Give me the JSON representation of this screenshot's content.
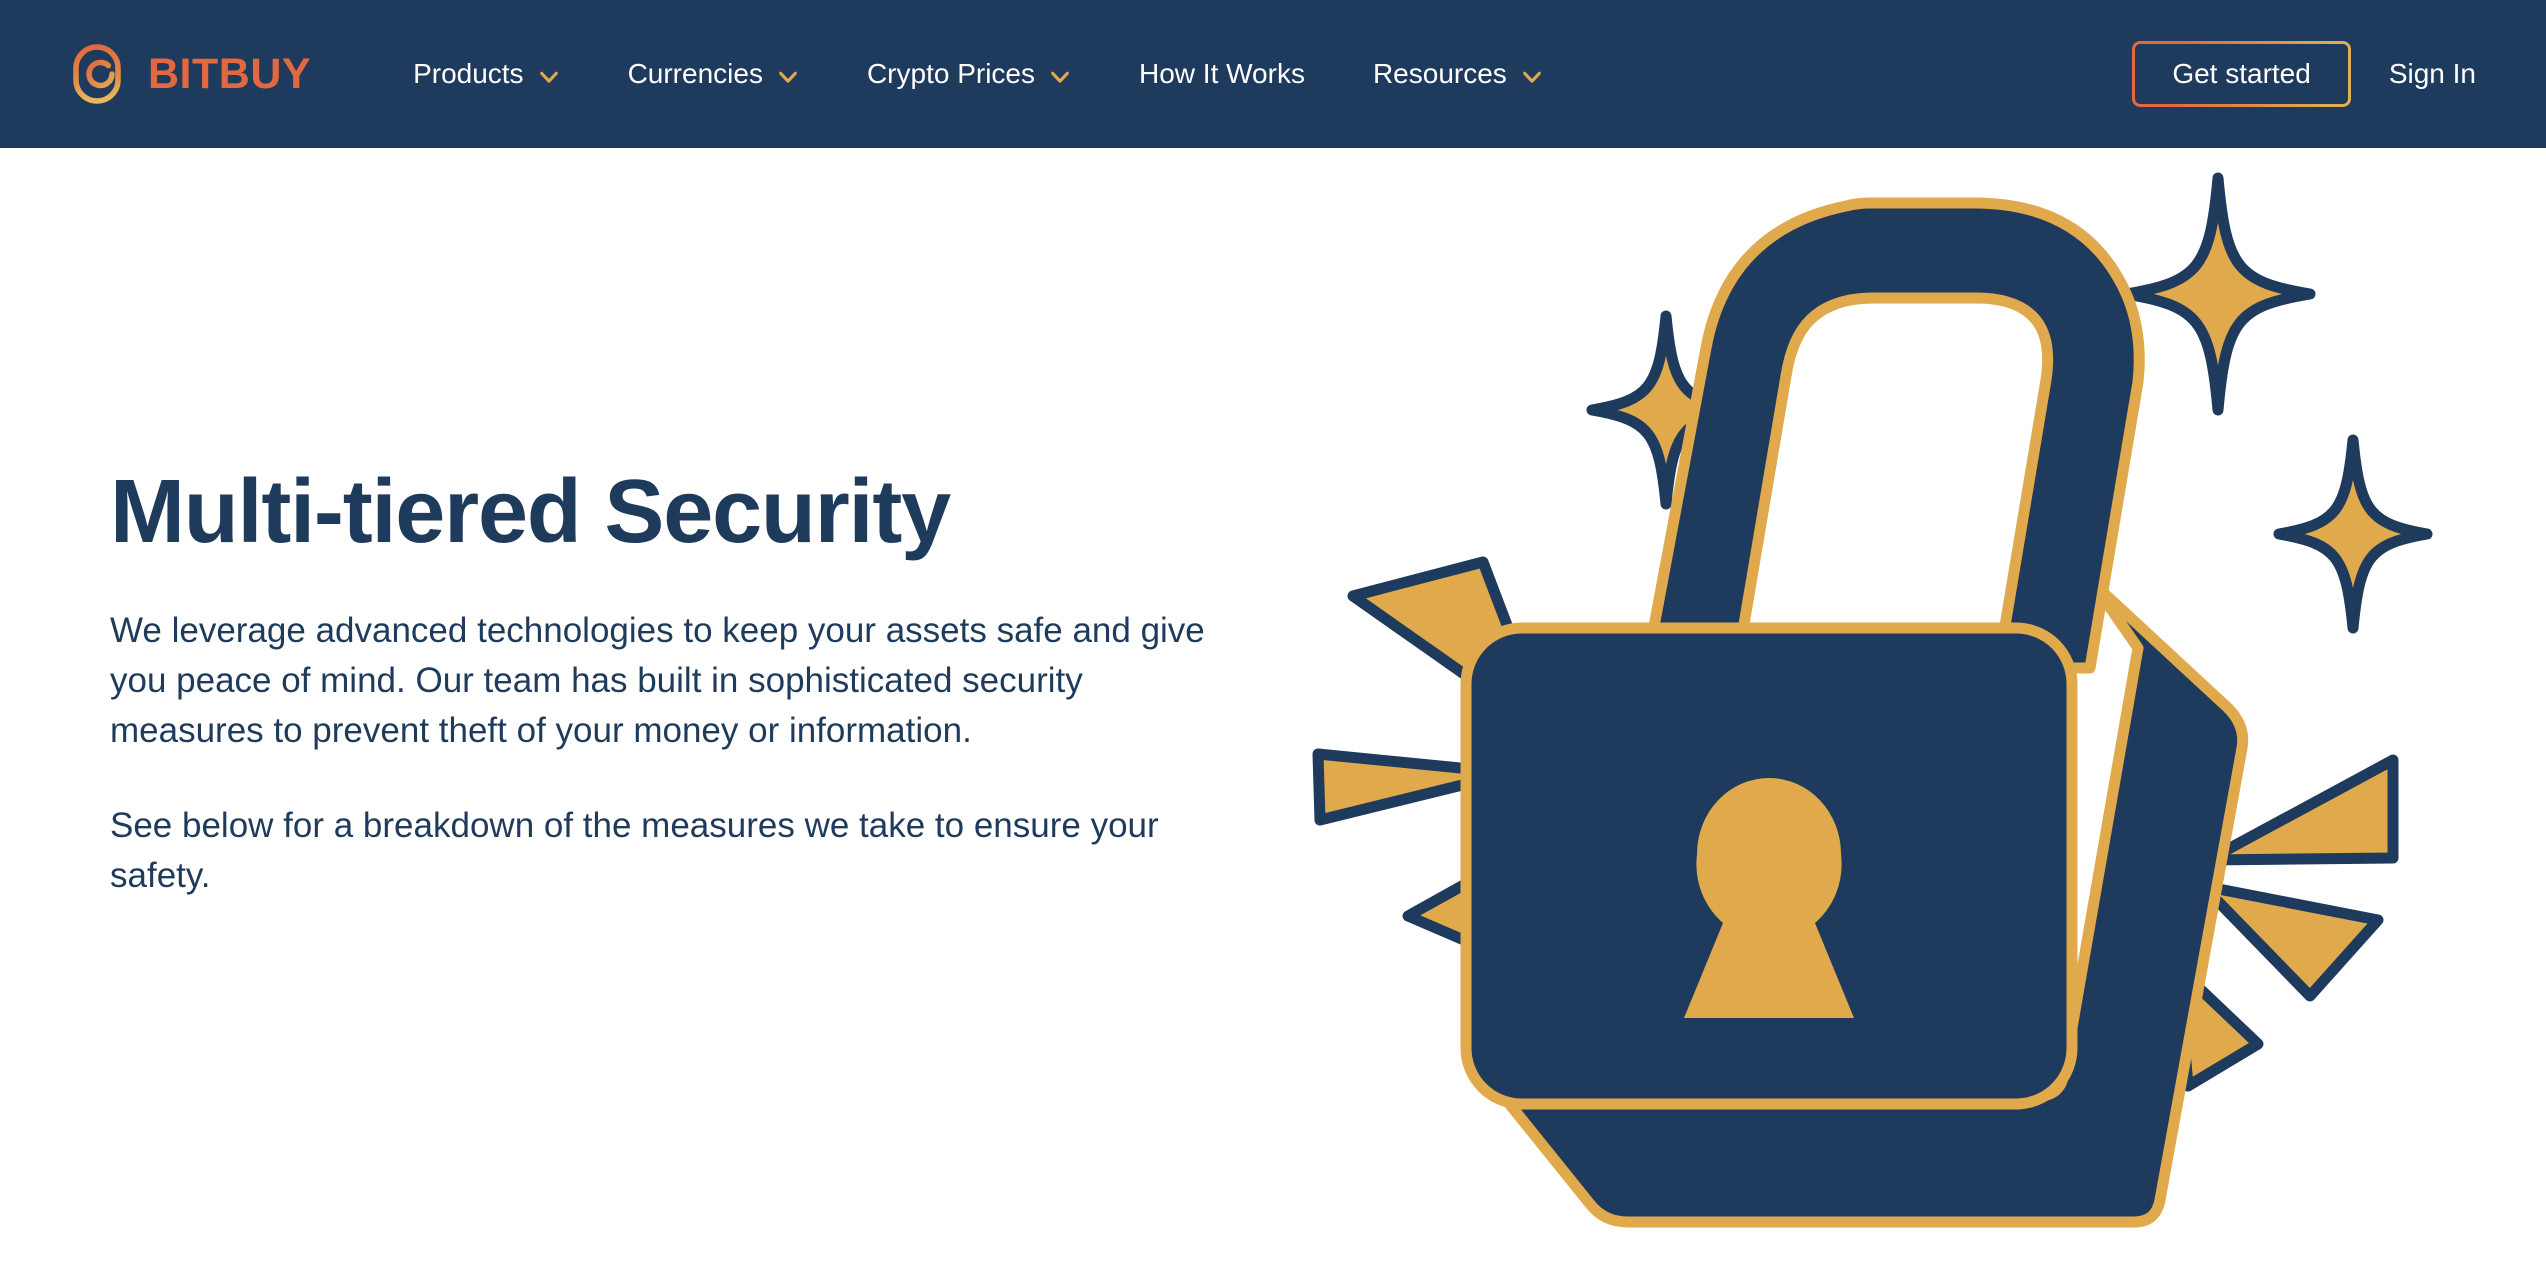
{
  "brand": {
    "name": "BITBUY",
    "logo_icon": "bitbuy-circle-logo",
    "logo_color": "#e2693f"
  },
  "nav": {
    "items": [
      {
        "label": "Products",
        "has_dropdown": true,
        "icon": "chevron-down-icon"
      },
      {
        "label": "Currencies",
        "has_dropdown": true,
        "icon": "chevron-down-icon"
      },
      {
        "label": "Crypto Prices",
        "has_dropdown": true,
        "icon": "chevron-down-icon"
      },
      {
        "label": "How It Works",
        "has_dropdown": false,
        "icon": ""
      },
      {
        "label": "Resources",
        "has_dropdown": true,
        "icon": "chevron-down-icon"
      }
    ],
    "cta_label": "Get started",
    "signin_label": "Sign In",
    "background_color": "#1e3a5c",
    "link_color": "#ffffff",
    "chevron_color": "#e0a94c"
  },
  "hero": {
    "title": "Multi-tiered Security",
    "paragraph_1": "We leverage advanced technologies to keep your assets safe and give you peace of mind. Our team has built in sophisticated security measures to prevent theft of your money or information.",
    "paragraph_2": "See below for a breakdown of the measures we take to ensure your safety.",
    "title_color": "#1f3b5c",
    "body_color": "#1f3b5c"
  },
  "illustration": {
    "name": "padlock-security-illustration",
    "lock_fill": "#1e3a5c",
    "lock_outline": "#e0a94c",
    "keyhole_color": "#e0a94c",
    "sparkle_fill": "#e0a94c",
    "sparkle_outline": "#1e3a5c",
    "ray_fill": "#e0a94c",
    "ray_outline": "#1e3a5c",
    "sparkle_count": 3,
    "ray_count": 6
  }
}
